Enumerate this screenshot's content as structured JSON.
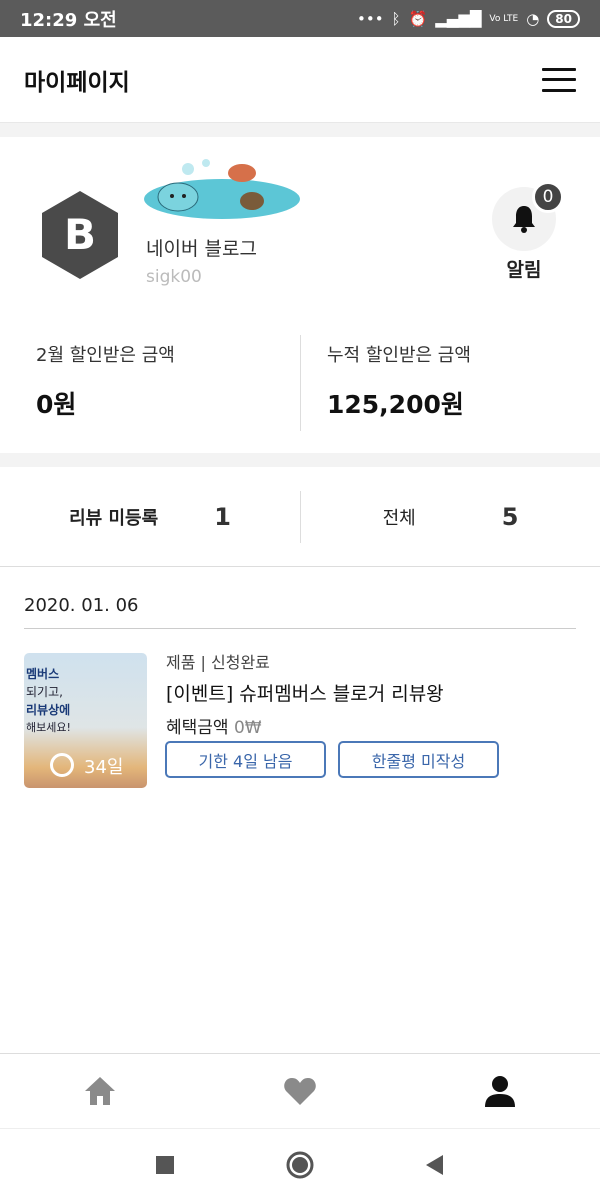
{
  "status_bar": {
    "time": "12:29 오전",
    "battery": "80",
    "network": "Vo LTE"
  },
  "header": {
    "title": "마이페이지"
  },
  "profile": {
    "avatar_letter": "B",
    "blog_name": "네이버 블로그",
    "blog_id": "sigk00",
    "alarm": {
      "count": "0",
      "label": "알림"
    }
  },
  "amounts": {
    "monthly_label": "2월 할인받은 금액",
    "monthly_value": "0원",
    "total_label": "누적 할인받은 금액",
    "total_value": "125,200원"
  },
  "reviews": {
    "unregistered_label": "리뷰 미등록",
    "unregistered_count": "1",
    "all_label": "전체",
    "all_count": "5"
  },
  "list": {
    "date": "2020. 01. 06",
    "items": [
      {
        "thumb_lines": [
          "멤버스",
          "되기고,",
          "리뷰상에",
          "해보세요!"
        ],
        "days": "34일",
        "meta": "제품 | 신청완료",
        "title": "[이벤트] 슈퍼멤버스 블로거 리뷰왕",
        "benefit_label": "혜택금액",
        "benefit_value": "0₩",
        "deadline_button": "기한 4일 남음",
        "review_button": "한줄평 미작성"
      }
    ]
  },
  "colors": {
    "accent": "#4b78b8",
    "status_bar": "#5b5b5b",
    "hex_avatar": "#4a4a4a"
  },
  "bottom_nav": {
    "icons": [
      "home-icon",
      "heart-icon",
      "person-icon"
    ]
  }
}
